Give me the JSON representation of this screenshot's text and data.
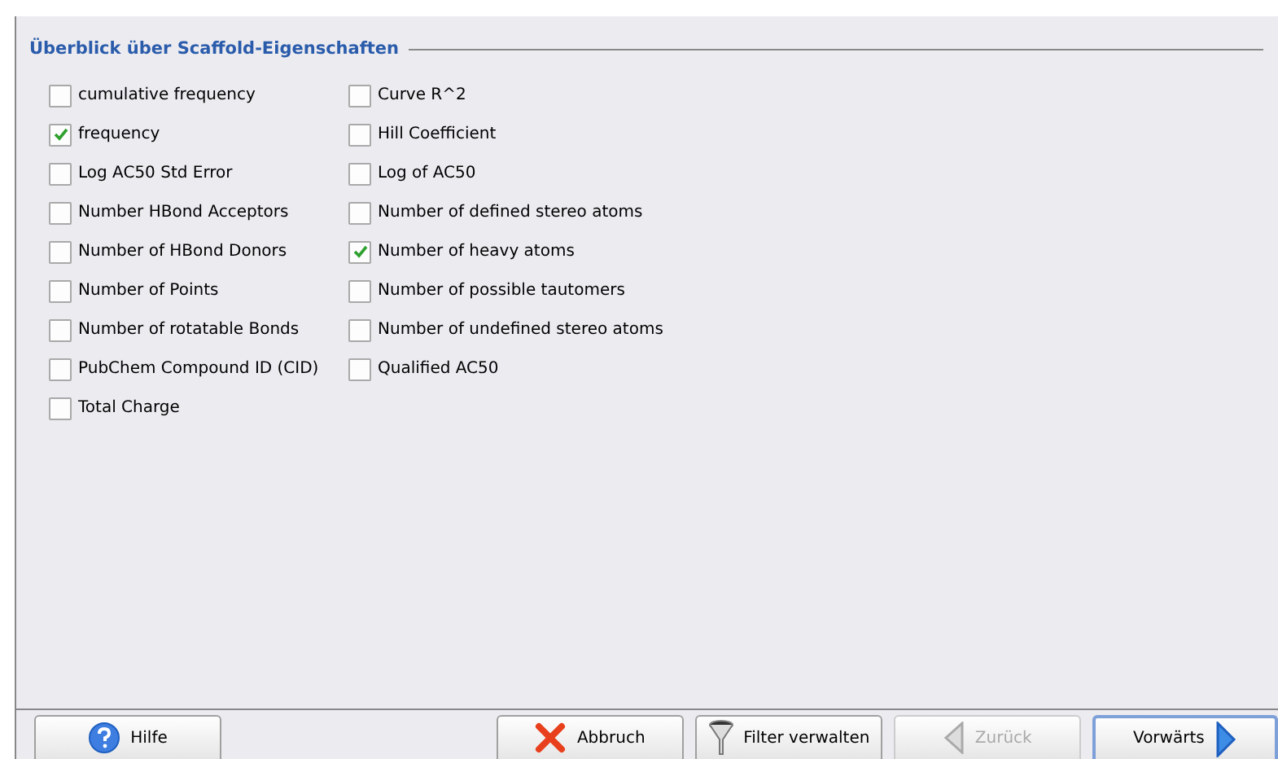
{
  "section_title": "Überblick über Scaffold-Eigenschaften",
  "columns": [
    [
      {
        "label": "cumulative frequency",
        "checked": false
      },
      {
        "label": "frequency",
        "checked": true
      },
      {
        "label": "Log AC50 Std Error",
        "checked": false
      },
      {
        "label": "Number HBond Acceptors",
        "checked": false
      },
      {
        "label": "Number of HBond Donors",
        "checked": false
      },
      {
        "label": "Number of Points",
        "checked": false
      },
      {
        "label": "Number of rotatable Bonds",
        "checked": false
      },
      {
        "label": "PubChem Compound ID (CID)",
        "checked": false
      },
      {
        "label": "Total Charge",
        "checked": false
      }
    ],
    [
      {
        "label": "Curve R^2",
        "checked": false
      },
      {
        "label": "Hill Coefficient",
        "checked": false
      },
      {
        "label": "Log of AC50",
        "checked": false
      },
      {
        "label": "Number of defined stereo atoms",
        "checked": false
      },
      {
        "label": "Number of heavy atoms",
        "checked": true
      },
      {
        "label": "Number of possible tautomers",
        "checked": false
      },
      {
        "label": "Number of undefined stereo atoms",
        "checked": false
      },
      {
        "label": "Qualified AC50",
        "checked": false
      }
    ]
  ],
  "buttons": [
    {
      "label": "Hilfe",
      "kind": "help",
      "disabled": false
    },
    {
      "label": "Abbruch",
      "kind": "cancel",
      "disabled": false
    },
    {
      "label": "Filter verwalten",
      "kind": "filter",
      "disabled": false
    },
    {
      "label": "Zurück",
      "kind": "back",
      "disabled": true
    },
    {
      "label": "Vorwärts",
      "kind": "next",
      "disabled": false
    }
  ]
}
